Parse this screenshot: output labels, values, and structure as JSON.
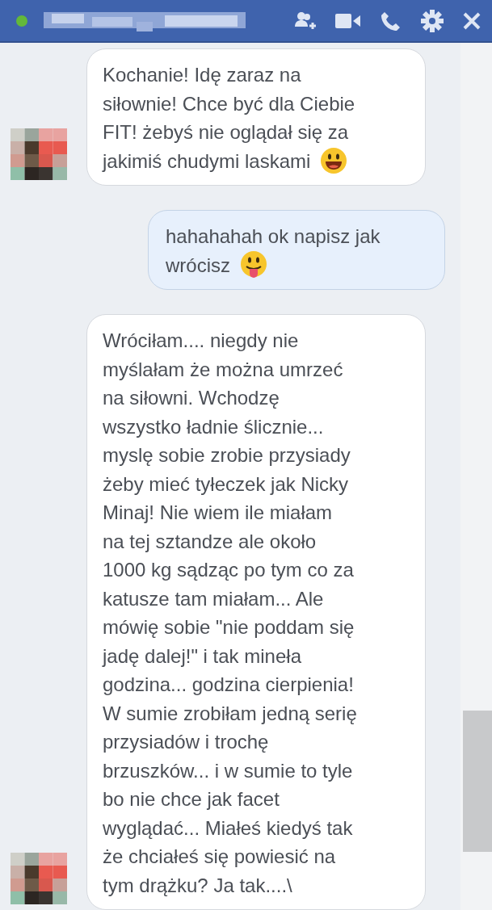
{
  "header": {
    "online": true
  },
  "messages": [
    {
      "kind": "incoming",
      "lines": [
        "Kochanie! Idę zaraz na",
        "siłownie! Chce być dla Ciebie",
        "FIT! żebyś nie oglądał się za",
        "jakimiś chudymi laskami"
      ],
      "emoji": {
        "kind": "grin"
      }
    },
    {
      "kind": "outgoing",
      "lines": [
        "hahahahah ok napisz jak",
        "wrócisz"
      ],
      "emoji": {
        "kind": "tongue"
      }
    },
    {
      "kind": "incoming",
      "lines": [
        "Wróciłam.... niegdy nie",
        "myślałam że można umrzeć",
        "na siłowni. Wchodzę",
        "wszystko ładnie ślicznie...",
        "myslę sobie zrobie przysiady",
        "żeby mieć tyłeczek jak Nicky",
        "Minaj! Nie wiem ile miałam",
        "na tej sztandze ale około",
        "1000 kg sądząc po tym co za",
        "katusze tam miałam... Ale",
        "mówię sobie \"nie poddam się",
        "jadę dalej!\" i tak mineła",
        "godzina... godzina cierpienia!",
        "W sumie zrobiłam jedną serię",
        "przysiadów i trochę",
        "brzuszków... i w sumie to tyle",
        "bo nie chce jak facet",
        "wyglądać... Miałeś kiedyś tak",
        "że chciałeś się powiesić na",
        "tym drążku? Ja tak....\\"
      ]
    }
  ]
}
